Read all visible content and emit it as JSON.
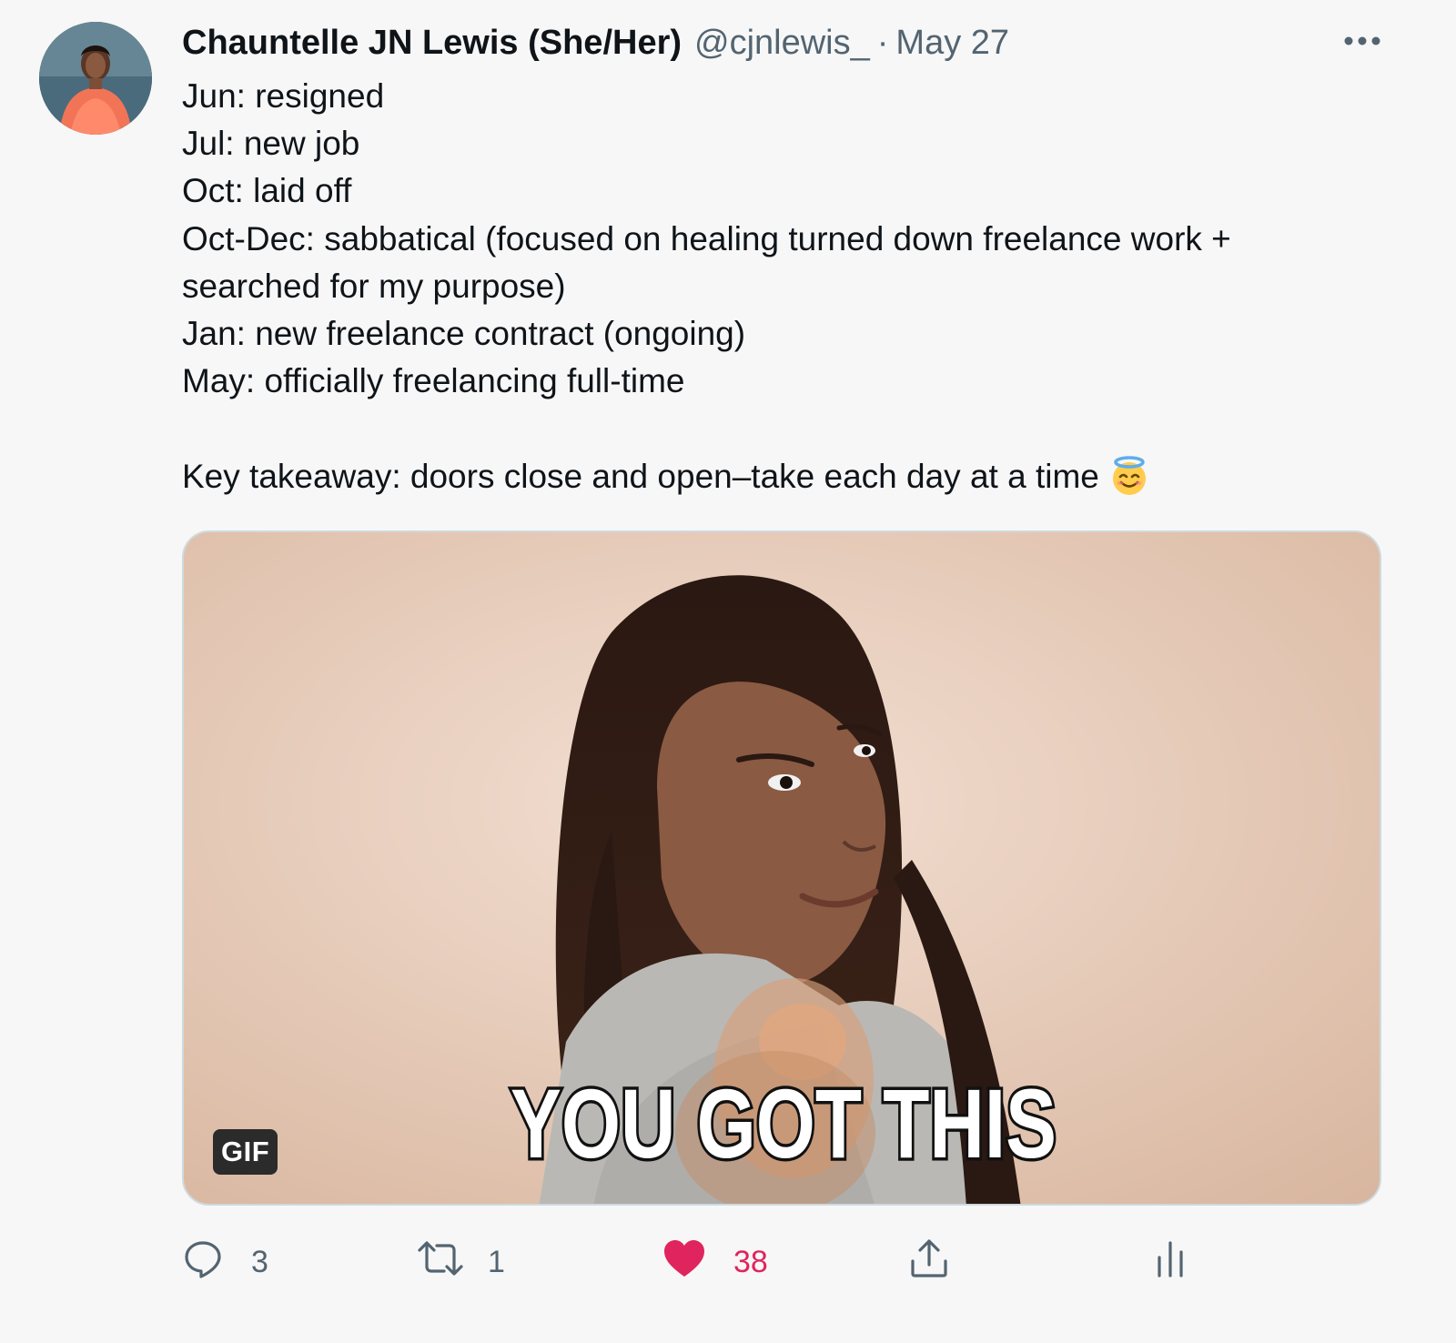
{
  "tweet": {
    "author": {
      "display_name": "Chauntelle JN Lewis (She/Her)",
      "handle": "@cjnlewis_",
      "separator": "·",
      "date": "May 27"
    },
    "more_icon": "ellipsis-icon",
    "body_lines": [
      "Jun: resigned",
      "Jul: new job",
      "Oct: laid off",
      "Oct-Dec: sabbatical (focused on healing turned down freelance work +",
      "searched for my purpose)",
      "Jan: new freelance contract (ongoing)",
      "May: officially freelancing full-time",
      "",
      "Key takeaway: doors close and open–take each day at a time"
    ],
    "emoji": "smiling-face-with-halo",
    "media": {
      "caption": "YOU GOT THIS",
      "badge": "GIF"
    },
    "actions": {
      "reply": {
        "icon": "reply-bubble-icon",
        "count": "3"
      },
      "retweet": {
        "icon": "retweet-icon",
        "count": "1"
      },
      "like": {
        "icon": "heart-icon",
        "count": "38",
        "liked": true,
        "color": "#e0245e"
      },
      "share": {
        "icon": "share-upload-icon"
      },
      "analytics": {
        "icon": "analytics-bars-icon"
      }
    }
  }
}
